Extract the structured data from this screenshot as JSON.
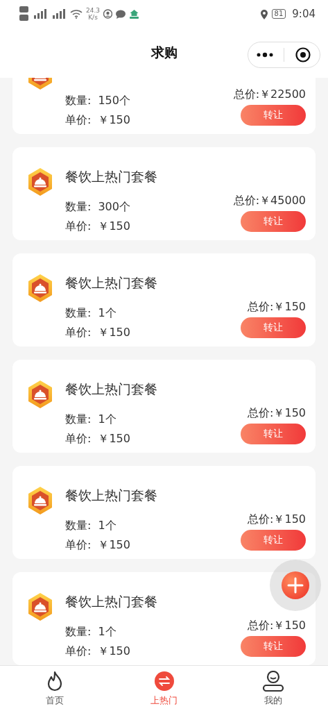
{
  "status_bar": {
    "net_speed": "24.3",
    "net_unit": "K/s",
    "battery": "81",
    "time": "9:04"
  },
  "header": {
    "title": "求购"
  },
  "orders": [
    {
      "quantity_label": "数量:",
      "quantity": "150个",
      "price_label": "单价:",
      "price": "￥150",
      "total": "总价:￥22500",
      "action": "转让"
    },
    {
      "title": "餐饮上热门套餐",
      "quantity_label": "数量:",
      "quantity": "300个",
      "price_label": "单价:",
      "price": "￥150",
      "total": "总价:￥45000",
      "action": "转让"
    },
    {
      "title": "餐饮上热门套餐",
      "quantity_label": "数量:",
      "quantity": "1个",
      "price_label": "单价:",
      "price": "￥150",
      "total": "总价:￥150",
      "action": "转让"
    },
    {
      "title": "餐饮上热门套餐",
      "quantity_label": "数量:",
      "quantity": "1个",
      "price_label": "单价:",
      "price": "￥150",
      "total": "总价:￥150",
      "action": "转让"
    },
    {
      "title": "餐饮上热门套餐",
      "quantity_label": "数量:",
      "quantity": "1个",
      "price_label": "单价:",
      "price": "￥150",
      "total": "总价:￥150",
      "action": "转让"
    },
    {
      "title": "餐饮上热门套餐",
      "quantity_label": "数量:",
      "quantity": "1个",
      "price_label": "单价:",
      "price": "￥150",
      "total": "总价:￥150",
      "action": "转让"
    }
  ],
  "fab": {
    "kind": "add"
  },
  "tab_bar": [
    {
      "label": "首页",
      "kind": "home",
      "selected": false
    },
    {
      "label": "上热门",
      "kind": "promote",
      "selected": true
    },
    {
      "label": "我的",
      "kind": "profile",
      "selected": false
    }
  ]
}
